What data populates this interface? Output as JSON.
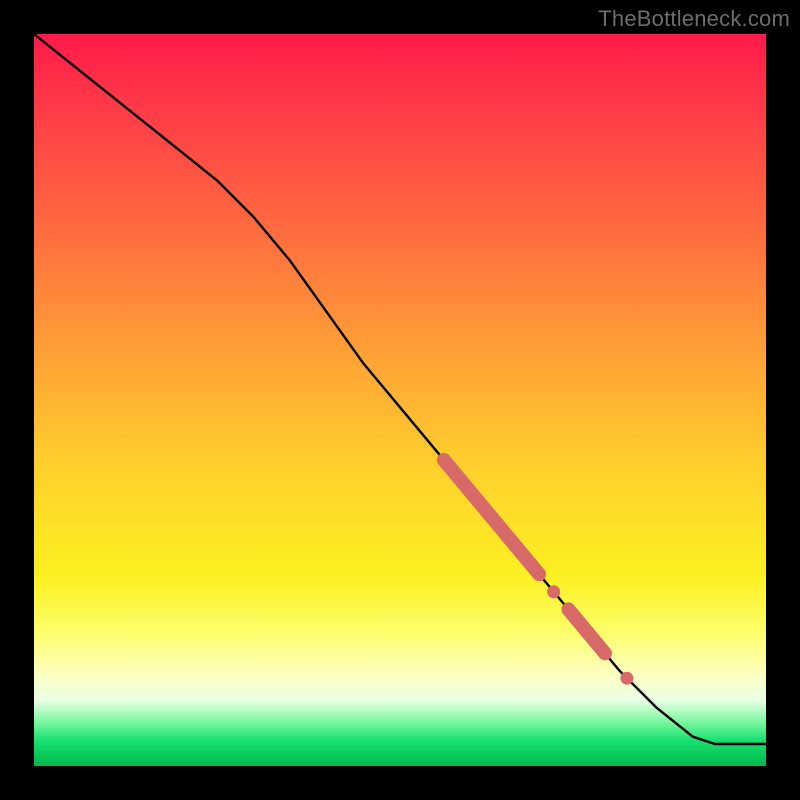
{
  "watermark": "TheBottleneck.com",
  "colors": {
    "gradient_top": "#ff1a49",
    "gradient_mid": "#ffd22c",
    "gradient_bottom": "#05b850",
    "line": "#000000",
    "highlight": "#d76a69",
    "frame": "#000000"
  },
  "chart_data": {
    "type": "line",
    "title": "",
    "xlabel": "",
    "ylabel": "",
    "xlim": [
      0,
      100
    ],
    "ylim": [
      0,
      100
    ],
    "grid": false,
    "legend": false,
    "series": [
      {
        "name": "main-curve",
        "x": [
          0,
          5,
          10,
          15,
          20,
          25,
          30,
          35,
          40,
          45,
          50,
          55,
          60,
          65,
          70,
          75,
          80,
          85,
          90,
          93,
          100
        ],
        "y": [
          100,
          96,
          92,
          88,
          84,
          80,
          75,
          69,
          62,
          55,
          49,
          43,
          37,
          31,
          25,
          19,
          13,
          8,
          4,
          3,
          3
        ]
      }
    ],
    "highlights": [
      {
        "kind": "segment",
        "x0": 56,
        "x1": 69,
        "thickness": "thick"
      },
      {
        "kind": "dot",
        "x": 71
      },
      {
        "kind": "segment",
        "x0": 73,
        "x1": 78,
        "thickness": "thick"
      },
      {
        "kind": "dot",
        "x": 81
      }
    ],
    "background": "vertical-gradient red→yellow→green"
  }
}
